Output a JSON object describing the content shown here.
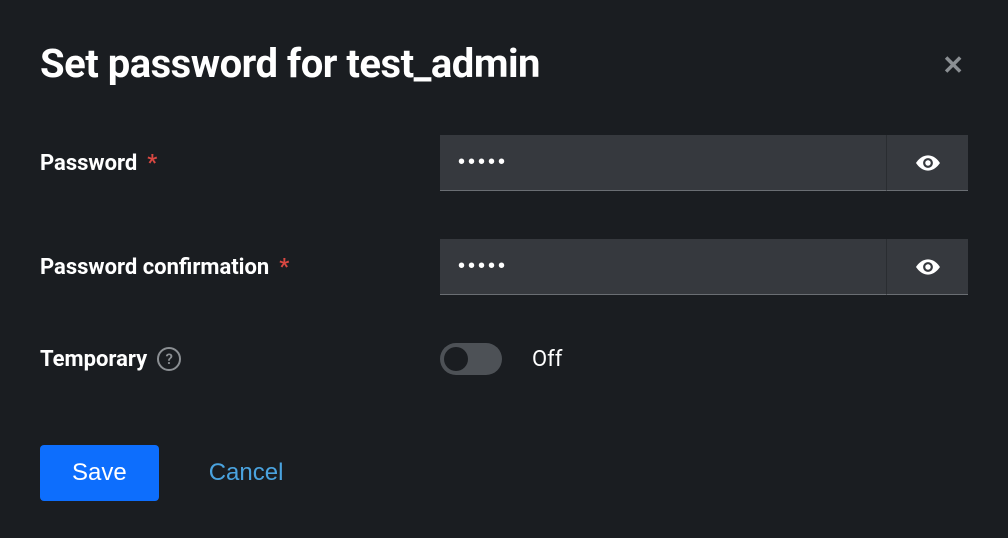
{
  "modal": {
    "title": "Set password for test_admin"
  },
  "form": {
    "password": {
      "label": "Password",
      "value": "•••••"
    },
    "passwordConfirm": {
      "label": "Password confirmation",
      "value": "•••••"
    },
    "temporary": {
      "label": "Temporary",
      "state": "Off",
      "on": false
    }
  },
  "buttons": {
    "save": "Save",
    "cancel": "Cancel"
  }
}
